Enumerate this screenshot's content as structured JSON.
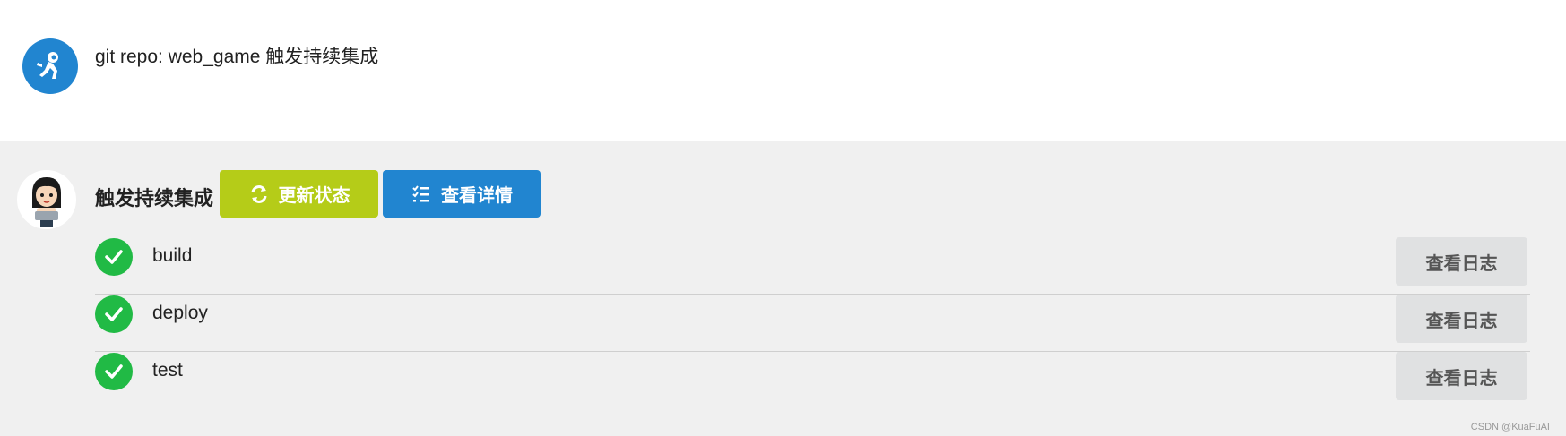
{
  "header": {
    "avatar_icon": "astronaut-icon",
    "title": "git repo: web_game 触发持续集成"
  },
  "pipeline": {
    "user_avatar": "user-avatar",
    "title": "触发持续集成",
    "refresh_label": "更新状态",
    "details_label": "查看详情",
    "colors": {
      "refresh": "#b5cc18",
      "details": "#2185d0",
      "success": "#21ba45"
    }
  },
  "jobs": [
    {
      "name": "build",
      "status": "success",
      "log_label": "查看日志"
    },
    {
      "name": "deploy",
      "status": "success",
      "log_label": "查看日志"
    },
    {
      "name": "test",
      "status": "success",
      "log_label": "查看日志"
    }
  ],
  "watermark": "CSDN @KuaFuAI"
}
